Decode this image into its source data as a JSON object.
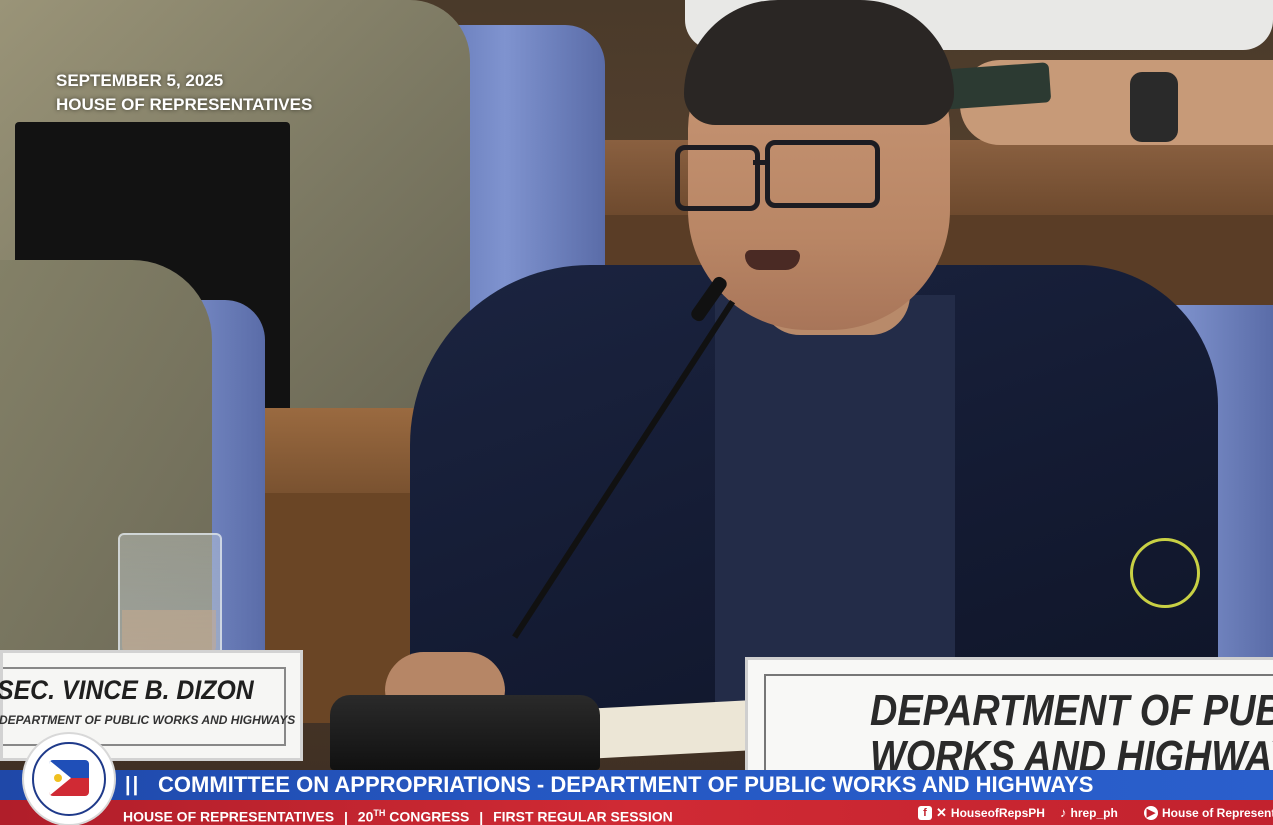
{
  "overlay": {
    "date": "SEPTEMBER 5, 2025",
    "venue": "HOUSE OF REPRESENTATIVES"
  },
  "placards": {
    "speaker_name": "SEC. VINCE B. DIZON",
    "speaker_department": "DEPARTMENT OF PUBLIC WORKS AND HIGHWAYS",
    "department_line1": "DEPARTMENT OF PUBLIC",
    "department_line2": "WORKS AND HIGHWAYS"
  },
  "lower_third": {
    "divider": "||",
    "title": "COMMITTEE ON APPROPRIATIONS - DEPARTMENT OF PUBLIC WORKS AND HIGHWAYS",
    "house": "HOUSE OF REPRESENTATIVES",
    "sep": "|",
    "congress_num": "20",
    "congress_sup": "TH",
    "congress_word": "CONGRESS",
    "session": "FIRST REGULAR SESSION"
  },
  "social": {
    "facebook_x_handle": "HouseofRepsPH",
    "tiktok_handle": "hrep_ph",
    "youtube_handle": "House of Representa",
    "icons": [
      "facebook-icon",
      "x-icon",
      "tiktok-icon",
      "youtube-icon"
    ]
  },
  "logo": {
    "icon": "house-of-representatives-seal-icon"
  },
  "colors": {
    "title_bar": "#2557c2",
    "sub_bar": "#d02a34"
  }
}
